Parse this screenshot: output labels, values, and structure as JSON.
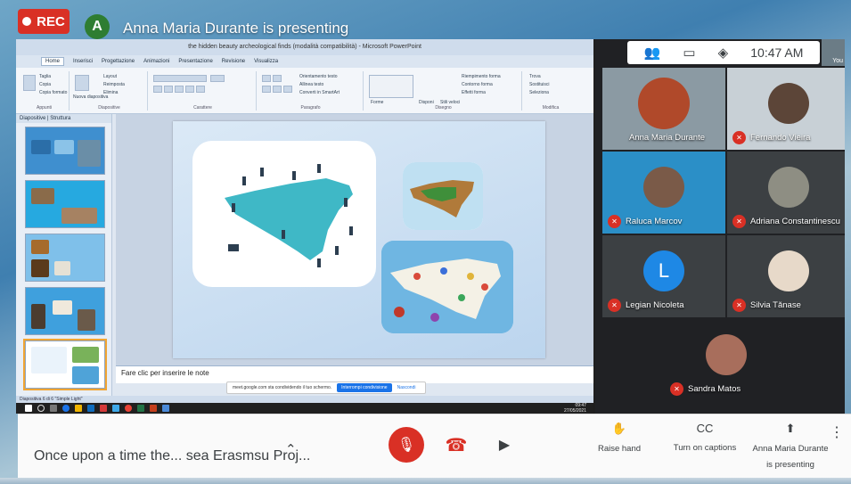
{
  "header": {
    "rec_label": "REC",
    "presenter_initial": "A",
    "presenter_title": "Anna Maria Durante is presenting",
    "accent_rec": "#d93025"
  },
  "ppt": {
    "window_title": "the hidden beauty archeological finds (modalità compatibilità) - Microsoft PowerPoint",
    "tabs": [
      "Home",
      "Inserisci",
      "Progettazione",
      "Animazioni",
      "Presentazione",
      "Revisione",
      "Visualizza"
    ],
    "ribbon_groups": [
      "Appunti",
      "Diapositive",
      "Carattere",
      "Paragrafo",
      "Disegno",
      "Modifica"
    ],
    "ribbon_items": [
      "Taglia",
      "Copia",
      "Copia formato",
      "Nuova diapositiva",
      "Layout",
      "Reimposta",
      "Elimina",
      "Orientamento testo",
      "Allinea testo",
      "Converti in SmartArt",
      "Forme",
      "Disponi",
      "Stili veloci",
      "Riempimento forma",
      "Contorno forma",
      "Effetti forma",
      "Trova",
      "Sostituisci",
      "Seleziona"
    ],
    "pane_tabs": [
      "Diapositive",
      "Struttura"
    ],
    "thumbnails": [
      {
        "number": "2"
      },
      {
        "number": "3"
      },
      {
        "number": "4"
      },
      {
        "number": "5"
      },
      {
        "number": "6"
      }
    ],
    "notes_placeholder": "Fare clic per inserire le note",
    "status_text": "Diapositiva 6 di 6   \"Simple Light\"",
    "share_notice": {
      "text": "meet.google.com sta condividendo il tuo schermo.",
      "stop_label": "Interrompi condivisione",
      "hide_label": "Nascondi"
    },
    "clock_time": "09:47",
    "clock_date": "27/05/2021"
  },
  "meet": {
    "clock": "10:47 AM",
    "self_label": "You",
    "participants": [
      {
        "name": "Anna Maria Durante",
        "muted": false,
        "type": "video"
      },
      {
        "name": "Fernando Vieira",
        "muted": true,
        "type": "video"
      },
      {
        "name": "Raluca Marcov",
        "muted": true,
        "type": "video"
      },
      {
        "name": "Adriana Constantinescu",
        "muted": true,
        "type": "photo"
      },
      {
        "name": "Legian Nicoleta",
        "muted": true,
        "type": "initial",
        "initial": "L"
      },
      {
        "name": "Silvia Tănase",
        "muted": true,
        "type": "photo"
      },
      {
        "name": "Sandra Matos",
        "muted": true,
        "type": "photo"
      }
    ]
  },
  "controls": {
    "meeting_name": "Once upon a time the... sea Erasmsu Proj...",
    "raise_hand": "Raise hand",
    "captions": "Turn on captions",
    "presenting": "Anna Maria Durante is presenting"
  }
}
